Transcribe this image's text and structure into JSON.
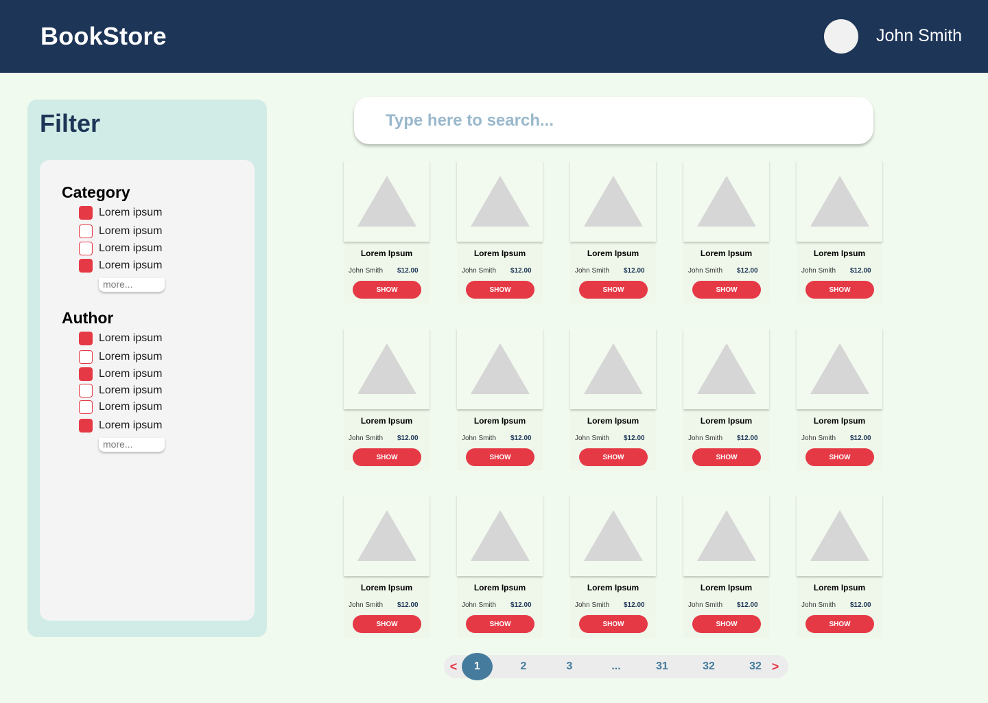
{
  "header": {
    "brand": "BookStore",
    "user_name": "John Smith"
  },
  "filter": {
    "title": "Filter",
    "groups": [
      {
        "title": "Category",
        "options": [
          {
            "label": "Lorem ipsum",
            "checked": true
          },
          {
            "label": "Lorem ipsum",
            "checked": false
          },
          {
            "label": "Lorem ipsum",
            "checked": false
          },
          {
            "label": "Lorem ipsum",
            "checked": true
          }
        ],
        "more_label": "more..."
      },
      {
        "title": "Author",
        "options": [
          {
            "label": "Lorem ipsum",
            "checked": true
          },
          {
            "label": "Lorem ipsum",
            "checked": false
          },
          {
            "label": "Lorem ipsum",
            "checked": true
          },
          {
            "label": "Lorem ipsum",
            "checked": false
          },
          {
            "label": "Lorem ipsum",
            "checked": false
          },
          {
            "label": "Lorem ipsum",
            "checked": true
          }
        ],
        "more_label": "more..."
      }
    ]
  },
  "search": {
    "placeholder": "Type here to search...",
    "value": ""
  },
  "products": [
    {
      "title": "Lorem Ipsum",
      "author": "John Smith",
      "price": "$12.00",
      "button": "SHOW"
    },
    {
      "title": "Lorem Ipsum",
      "author": "John Smith",
      "price": "$12.00",
      "button": "SHOW"
    },
    {
      "title": "Lorem Ipsum",
      "author": "John Smith",
      "price": "$12.00",
      "button": "SHOW"
    },
    {
      "title": "Lorem Ipsum",
      "author": "John Smith",
      "price": "$12.00",
      "button": "SHOW"
    },
    {
      "title": "Lorem Ipsum",
      "author": "John Smith",
      "price": "$12.00",
      "button": "SHOW"
    },
    {
      "title": "Lorem Ipsum",
      "author": "John Smith",
      "price": "$12.00",
      "button": "SHOW"
    },
    {
      "title": "Lorem Ipsum",
      "author": "John Smith",
      "price": "$12.00",
      "button": "SHOW"
    },
    {
      "title": "Lorem Ipsum",
      "author": "John Smith",
      "price": "$12.00",
      "button": "SHOW"
    },
    {
      "title": "Lorem Ipsum",
      "author": "John Smith",
      "price": "$12.00",
      "button": "SHOW"
    },
    {
      "title": "Lorem Ipsum",
      "author": "John Smith",
      "price": "$12.00",
      "button": "SHOW"
    },
    {
      "title": "Lorem Ipsum",
      "author": "John Smith",
      "price": "$12.00",
      "button": "SHOW"
    },
    {
      "title": "Lorem Ipsum",
      "author": "John Smith",
      "price": "$12.00",
      "button": "SHOW"
    },
    {
      "title": "Lorem Ipsum",
      "author": "John Smith",
      "price": "$12.00",
      "button": "SHOW"
    },
    {
      "title": "Lorem Ipsum",
      "author": "John Smith",
      "price": "$12.00",
      "button": "SHOW"
    },
    {
      "title": "Lorem Ipsum",
      "author": "John Smith",
      "price": "$12.00",
      "button": "SHOW"
    }
  ],
  "pagination": {
    "prev": "<",
    "next": ">",
    "pages": [
      "1",
      "2",
      "3",
      "...",
      "31",
      "32",
      "32"
    ],
    "current": "1"
  },
  "colors": {
    "header_bg": "#1d3557",
    "accent": "#e63946",
    "page_bg": "#f1faee",
    "pager_active": "#457b9d"
  },
  "icons": {
    "product_image": "image-placeholder-icon",
    "avatar": "user-avatar"
  }
}
